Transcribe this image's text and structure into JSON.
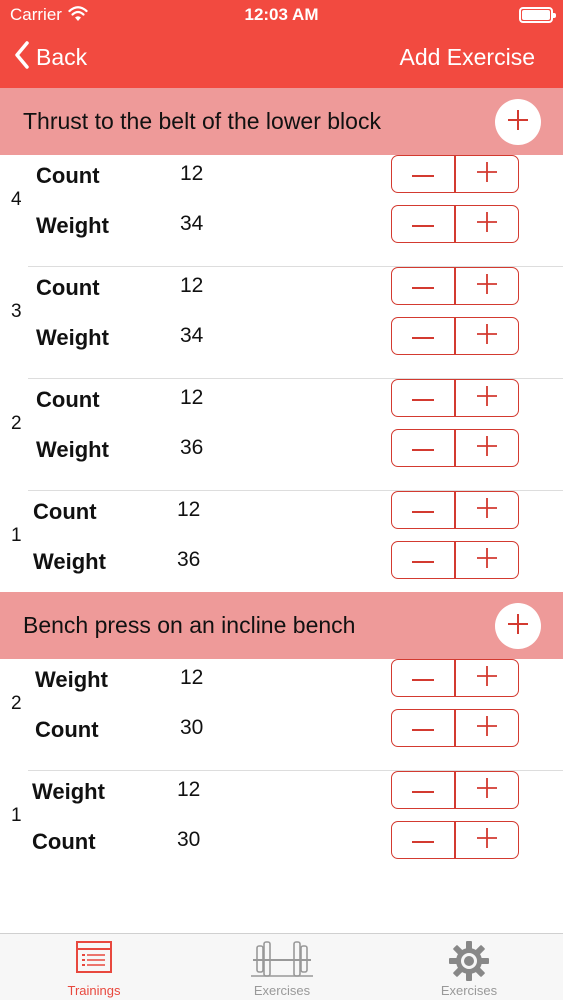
{
  "status_bar": {
    "carrier": "Carrier",
    "time": "12:03 AM"
  },
  "nav": {
    "back_label": "Back",
    "action_label": "Add Exercise"
  },
  "exercises": [
    {
      "title": "Thrust to the belt of the lower block",
      "sets": [
        {
          "number": "4",
          "rows": [
            {
              "label": "Count",
              "value": "12"
            },
            {
              "label": "Weight",
              "value": "34"
            }
          ]
        },
        {
          "number": "3",
          "rows": [
            {
              "label": "Count",
              "value": "12"
            },
            {
              "label": "Weight",
              "value": "34"
            }
          ]
        },
        {
          "number": "2",
          "rows": [
            {
              "label": "Count",
              "value": "12"
            },
            {
              "label": "Weight",
              "value": "36"
            }
          ]
        },
        {
          "number": "1",
          "rows": [
            {
              "label": "Count",
              "value": "12"
            },
            {
              "label": "Weight",
              "value": "36"
            }
          ]
        }
      ]
    },
    {
      "title": "Bench press on an incline bench",
      "sets": [
        {
          "number": "2",
          "rows": [
            {
              "label": "Weight",
              "value": "12"
            },
            {
              "label": "Count",
              "value": "30"
            }
          ]
        },
        {
          "number": "1",
          "rows": [
            {
              "label": "Weight",
              "value": "12"
            },
            {
              "label": "Count",
              "value": "30"
            }
          ]
        }
      ]
    }
  ],
  "tabs": [
    {
      "label": "Trainings",
      "icon": "list-icon",
      "active": true
    },
    {
      "label": "Exercises",
      "icon": "barbell-icon",
      "active": false
    },
    {
      "label": "Exercises",
      "icon": "gear-icon",
      "active": false
    }
  ],
  "colors": {
    "accent": "#f24a40",
    "section_header": "#ee9a99",
    "stepper_border": "#d33a30",
    "tab_inactive": "#999999"
  }
}
